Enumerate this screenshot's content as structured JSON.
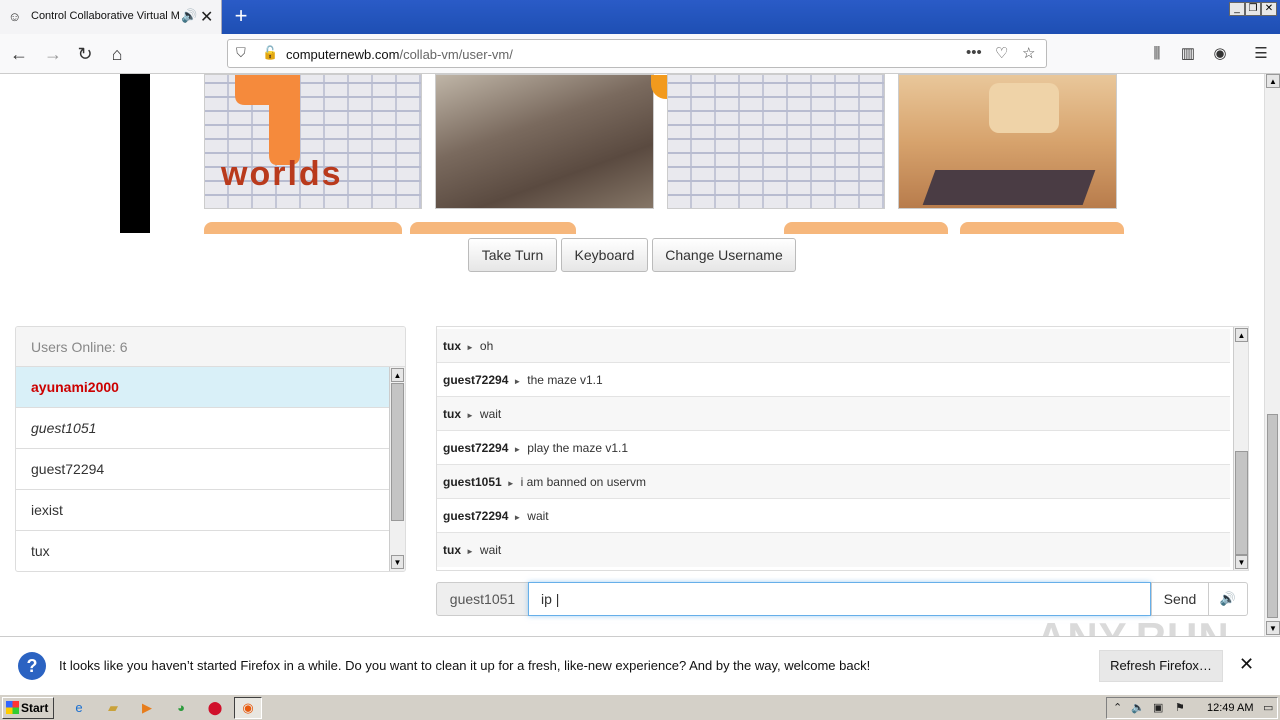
{
  "browser": {
    "tab_title": "Control Collaborative Virtual M",
    "tab_audio_icon": "speaker-icon",
    "url_domain": "computernewb.com",
    "url_path": "/collab-vm/user-vm/",
    "url_more": "•••"
  },
  "vm": {
    "buttons": {
      "take_turn": "Take Turn",
      "keyboard": "Keyboard",
      "change_username": "Change Username"
    },
    "thumb_text": "worlds"
  },
  "users": {
    "header": "Users Online: 6",
    "list": [
      {
        "name": "ayunami2000",
        "style": "me"
      },
      {
        "name": "guest1051",
        "style": "guest"
      },
      {
        "name": "guest72294",
        "style": "normal"
      },
      {
        "name": "iexist",
        "style": "normal"
      },
      {
        "name": "tux",
        "style": "normal"
      }
    ]
  },
  "chat": {
    "messages": [
      {
        "user": "tux",
        "text": "oh"
      },
      {
        "user": "guest72294",
        "text": "the maze v1.1"
      },
      {
        "user": "tux",
        "text": "wait"
      },
      {
        "user": "guest72294",
        "text": "play the maze v1.1"
      },
      {
        "user": "guest1051",
        "text": "i am banned on uservm"
      },
      {
        "user": "guest72294",
        "text": "wait"
      },
      {
        "user": "tux",
        "text": "wait"
      }
    ],
    "username": "guest1051",
    "input_value": "ip |",
    "send_label": "Send"
  },
  "notification": {
    "message": "It looks like you haven’t started Firefox in a while. Do you want to clean it up for a fresh, like-new experience? And by the way, welcome back!",
    "refresh_label": "Refresh Firefox…",
    "close": "✕"
  },
  "watermark": "ANY.RUN",
  "taskbar": {
    "start_label": "Start",
    "clock": "12:49 AM"
  }
}
